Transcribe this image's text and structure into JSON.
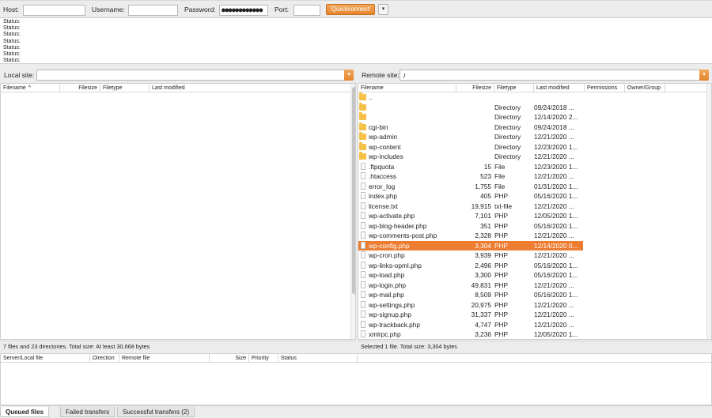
{
  "quickconnect": {
    "host_label": "Host:",
    "host_value": "",
    "username_label": "Username:",
    "username_value": "",
    "password_label": "Password:",
    "password_value": "●●●●●●●●●●●●",
    "port_label": "Port:",
    "port_value": "",
    "button_label": "Quickconnect",
    "dropdown_glyph": "▾"
  },
  "log": [
    "Status:",
    "Status:",
    "Status:",
    "Status:",
    "Status:",
    "Status:",
    "Status:"
  ],
  "local": {
    "site_label": "Local site:",
    "site_path": "",
    "columns": [
      "Filename",
      "Filesize",
      "Filetype",
      "Last modified"
    ],
    "status": "7 files and 23 directories. Total size: At least 30,668 bytes"
  },
  "remote": {
    "site_label": "Remote site:",
    "site_path": "/",
    "columns": [
      "Filename",
      "Filesize",
      "Filetype",
      "Last modified",
      "Permissions",
      "Owner/Group"
    ],
    "status": "Selected 1 file. Total size: 3,304 bytes",
    "files": [
      {
        "name": "..",
        "size": "",
        "type": "",
        "modified": "",
        "icon": "folder-icon",
        "selected": false
      },
      {
        "name": "",
        "size": "",
        "type": "Directory",
        "modified": "09/24/2018 ...",
        "icon": "folder-icon",
        "selected": false
      },
      {
        "name": "",
        "size": "",
        "type": "Directory",
        "modified": "12/14/2020 2...",
        "icon": "folder-icon",
        "selected": false
      },
      {
        "name": "cgi-bin",
        "size": "",
        "type": "Directory",
        "modified": "09/24/2018 ...",
        "icon": "folder-icon",
        "selected": false
      },
      {
        "name": "wp-admin",
        "size": "",
        "type": "Directory",
        "modified": "12/21/2020 ...",
        "icon": "folder-icon",
        "selected": false
      },
      {
        "name": "wp-content",
        "size": "",
        "type": "Directory",
        "modified": "12/23/2020 1...",
        "icon": "folder-icon",
        "selected": false
      },
      {
        "name": "wp-includes",
        "size": "",
        "type": "Directory",
        "modified": "12/21/2020 ...",
        "icon": "folder-icon",
        "selected": false
      },
      {
        "name": ".ftpquota",
        "size": "15",
        "type": "File",
        "modified": "12/23/2020 1...",
        "icon": "file-icon",
        "selected": false
      },
      {
        "name": ".htaccess",
        "size": "523",
        "type": "File",
        "modified": "12/21/2020 ...",
        "icon": "file-icon",
        "selected": false
      },
      {
        "name": "error_log",
        "size": "1,755",
        "type": "File",
        "modified": "01/31/2020 1...",
        "icon": "file-icon",
        "selected": false
      },
      {
        "name": "index.php",
        "size": "405",
        "type": "PHP",
        "modified": "05/16/2020 1...",
        "icon": "file-icon",
        "selected": false
      },
      {
        "name": "license.txt",
        "size": "19,915",
        "type": "txt-file",
        "modified": "12/21/2020 ...",
        "icon": "file-icon",
        "selected": false
      },
      {
        "name": "wp-activate.php",
        "size": "7,101",
        "type": "PHP",
        "modified": "12/05/2020 1...",
        "icon": "file-icon",
        "selected": false
      },
      {
        "name": "wp-blog-header.php",
        "size": "351",
        "type": "PHP",
        "modified": "05/16/2020 1...",
        "icon": "file-icon",
        "selected": false
      },
      {
        "name": "wp-comments-post.php",
        "size": "2,328",
        "type": "PHP",
        "modified": "12/21/2020 ...",
        "icon": "file-icon",
        "selected": false
      },
      {
        "name": "wp-config.php",
        "size": "3,304",
        "type": "PHP",
        "modified": "12/14/2020 0...",
        "icon": "file-icon",
        "selected": true
      },
      {
        "name": "wp-cron.php",
        "size": "3,939",
        "type": "PHP",
        "modified": "12/21/2020 ...",
        "icon": "file-icon",
        "selected": false
      },
      {
        "name": "wp-links-opml.php",
        "size": "2,496",
        "type": "PHP",
        "modified": "05/16/2020 1...",
        "icon": "file-icon",
        "selected": false
      },
      {
        "name": "wp-load.php",
        "size": "3,300",
        "type": "PHP",
        "modified": "05/16/2020 1...",
        "icon": "file-icon",
        "selected": false
      },
      {
        "name": "wp-login.php",
        "size": "49,831",
        "type": "PHP",
        "modified": "12/21/2020 ...",
        "icon": "file-icon",
        "selected": false
      },
      {
        "name": "wp-mail.php",
        "size": "8,509",
        "type": "PHP",
        "modified": "05/16/2020 1...",
        "icon": "file-icon",
        "selected": false
      },
      {
        "name": "wp-settings.php",
        "size": "20,975",
        "type": "PHP",
        "modified": "12/21/2020 ...",
        "icon": "file-icon",
        "selected": false
      },
      {
        "name": "wp-signup.php",
        "size": "31,337",
        "type": "PHP",
        "modified": "12/21/2020 ...",
        "icon": "file-icon",
        "selected": false
      },
      {
        "name": "wp-trackback.php",
        "size": "4,747",
        "type": "PHP",
        "modified": "12/21/2020 ...",
        "icon": "file-icon",
        "selected": false
      },
      {
        "name": "xmlrpc.php",
        "size": "3,236",
        "type": "PHP",
        "modified": "12/05/2020 1...",
        "icon": "file-icon",
        "selected": false
      }
    ]
  },
  "queue": {
    "columns": [
      "Server/Local file",
      "Direction",
      "Remote file",
      "Size",
      "Priority",
      "Status"
    ]
  },
  "tabs": [
    {
      "label": "Queued files",
      "active": true
    },
    {
      "label": "Failed transfers",
      "active": false
    },
    {
      "label": "Successful transfers (2)",
      "active": false
    }
  ],
  "colors": {
    "accent": "#ed7d31",
    "folder": "#f5c146"
  }
}
